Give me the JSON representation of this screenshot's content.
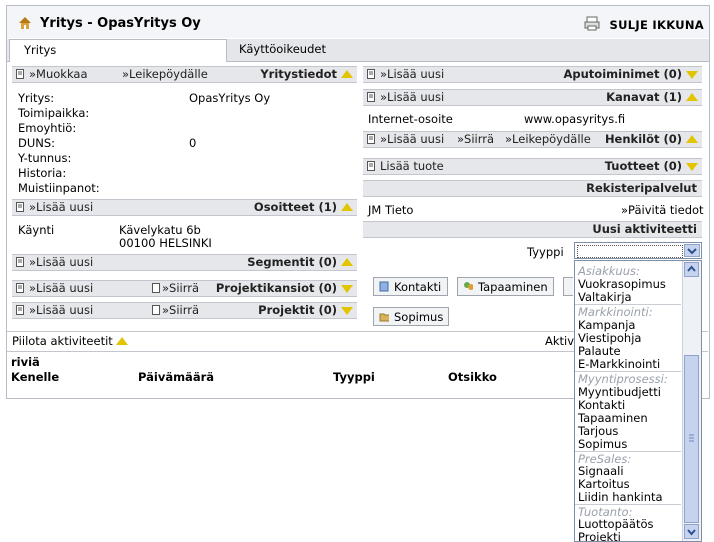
{
  "window": {
    "title": "Yritys - OpasYritys Oy",
    "close_label": "SULJE IKKUNA"
  },
  "tabs": [
    {
      "label": "Yritys",
      "active": true
    },
    {
      "label": "Käyttöoikeudet",
      "active": false
    }
  ],
  "company": {
    "bar": {
      "edit": "»Muokkaa",
      "clipboard": "»Leikepöydälle",
      "title": "Yritystiedot"
    },
    "fields": [
      {
        "label": "Yritys:",
        "value": "OpasYritys Oy"
      },
      {
        "label": "Toimipaikka:",
        "value": ""
      },
      {
        "label": "Emoyhtiö:",
        "value": ""
      },
      {
        "label": "DUNS:",
        "value": "0"
      },
      {
        "label": "Y-tunnus:",
        "value": ""
      },
      {
        "label": "Historia:",
        "value": ""
      },
      {
        "label": "Muistiinpanot:",
        "value": ""
      }
    ]
  },
  "addresses": {
    "bar": {
      "add": "»Lisää uusi",
      "title": "Osoitteet (1)"
    },
    "type": "Käynti",
    "street": "Kävelykatu 6b",
    "city": "00100 HELSINKI"
  },
  "segments": {
    "add": "»Lisää uusi",
    "title": "Segmentit (0)"
  },
  "project_folders": {
    "add": "»Lisää uusi",
    "move": "»Siirrä",
    "title": "Projektikansiot (0)"
  },
  "projects": {
    "add": "»Lisää uusi",
    "move": "»Siirrä",
    "title": "Projektit (0)"
  },
  "aux_names": {
    "add": "»Lisää uusi",
    "title": "Aputoiminimet (0)"
  },
  "channels": {
    "add": "»Lisää uusi",
    "title": "Kanavat (1)",
    "label": "Internet-osoite",
    "value": "www.opasyritys.fi"
  },
  "persons": {
    "add": "»Lisää uusi",
    "move": "»Siirrä",
    "clipboard": "»Leikepöydälle",
    "title": "Henkilöt (0)"
  },
  "products": {
    "add": "Lisää tuote",
    "title": "Tuotteet (0)"
  },
  "registry": {
    "title": "Rekisteripalvelut",
    "provider": "JM Tieto",
    "update": "»Päivitä tiedot"
  },
  "new_activity": {
    "title": "Uusi aktiviteetti",
    "type_label": "Tyyppi",
    "buttons": [
      "Kontakti",
      "Tapaaminen",
      "Sopimus"
    ]
  },
  "activities": {
    "hide": "Piilota aktiviteetit",
    "right_label": "Aktiv",
    "rows_label": "riviä",
    "columns": [
      "Kenelle",
      "Päivämäärä",
      "Tyyppi",
      "Otsikko"
    ]
  },
  "dropdown": {
    "groups": [
      {
        "name": "Asiakkuus:",
        "items": [
          "Vuokrasopimus",
          "Valtakirja"
        ]
      },
      {
        "name": "Markkinointi:",
        "items": [
          "Kampanja",
          "Viestipohja",
          "Palaute",
          "E-Markkinointi"
        ]
      },
      {
        "name": "Myyntiprosessi:",
        "items": [
          "Myyntibudjetti",
          "Kontakti",
          "Tapaaminen",
          "Tarjous",
          "Sopimus"
        ]
      },
      {
        "name": "PreSales:",
        "items": [
          "Signaali",
          "Kartoitus",
          "Liidin hankinta"
        ]
      },
      {
        "name": "Tuotanto:",
        "items": [
          "Luottopäätös",
          "Projekti"
        ]
      }
    ]
  },
  "colors": {
    "accent": "#e2c400",
    "bar_bg": "#e6e7ea",
    "select_border": "#7f8fa8"
  }
}
